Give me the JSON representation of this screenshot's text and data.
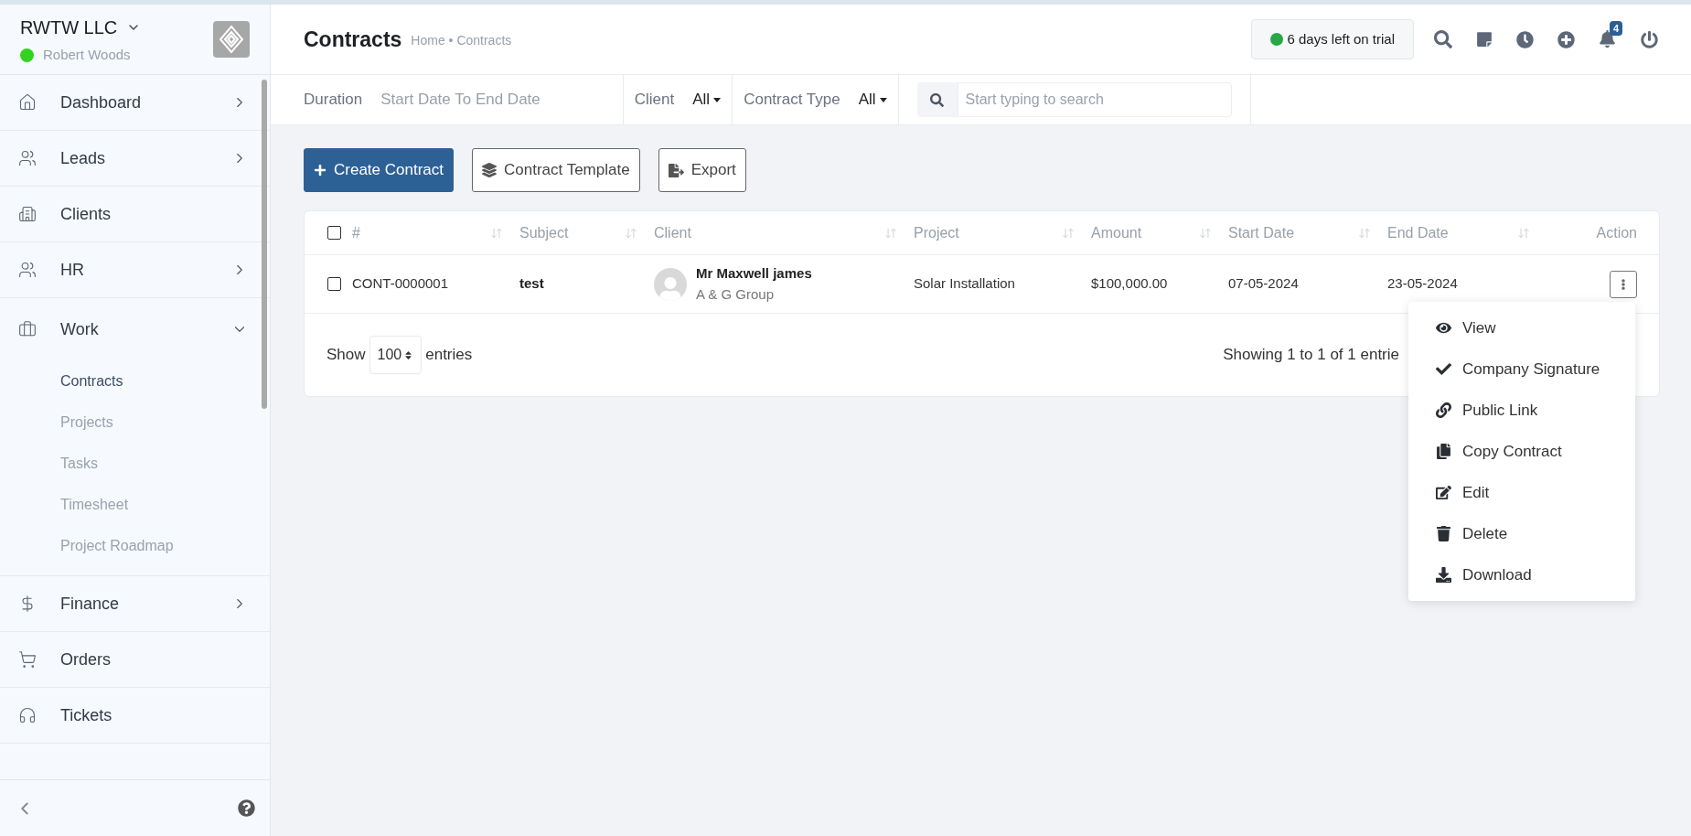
{
  "workspace": {
    "company": "RWTW LLC",
    "user": "Robert Woods",
    "online": true
  },
  "sidebar": {
    "items": [
      {
        "label": "Dashboard",
        "expandable": true,
        "expanded": false
      },
      {
        "label": "Leads",
        "expandable": true,
        "expanded": false
      },
      {
        "label": "Clients",
        "expandable": false,
        "expanded": false
      },
      {
        "label": "HR",
        "expandable": true,
        "expanded": false
      },
      {
        "label": "Work",
        "expandable": true,
        "expanded": true,
        "children": [
          {
            "label": "Contracts",
            "selected": true
          },
          {
            "label": "Projects",
            "selected": false
          },
          {
            "label": "Tasks",
            "selected": false
          },
          {
            "label": "Timesheet",
            "selected": false
          },
          {
            "label": "Project Roadmap",
            "selected": false
          }
        ]
      },
      {
        "label": "Finance",
        "expandable": true,
        "expanded": false
      },
      {
        "label": "Orders",
        "expandable": false,
        "expanded": false
      },
      {
        "label": "Tickets",
        "expandable": false,
        "expanded": false
      }
    ]
  },
  "header": {
    "title": "Contracts",
    "breadcrumb": "Home • Contracts",
    "trial": "6 days left on trial",
    "notifications": "4"
  },
  "filters": {
    "duration_label": "Duration",
    "duration_value": "Start Date To End Date",
    "client_label": "Client",
    "client_value": "All",
    "type_label": "Contract Type",
    "type_value": "All",
    "search": {
      "placeholder": "Start typing to search"
    }
  },
  "actions": [
    "Create Contract",
    "Contract Template",
    "Export"
  ],
  "table": {
    "columns": [
      "#",
      "Subject",
      "Client",
      "Project",
      "Amount",
      "Start Date",
      "End Date",
      "Action"
    ],
    "header_checked": false,
    "rows": [
      {
        "checked": false,
        "id": "CONT-0000001",
        "subject": "test",
        "client_name": "Mr Maxwell james",
        "client_company": "A & G Group",
        "project": "Solar Installation",
        "amount": "$100,000.00",
        "start": "07-05-2024",
        "end": "23-05-2024"
      }
    ],
    "show_label": "Show",
    "page_size": "100",
    "entries_label": "entries",
    "summary": "Showing 1 to 1 of 1 entrie"
  },
  "action_menu": [
    "View",
    "Company Signature",
    "Public Link",
    "Copy Contract",
    "Edit",
    "Delete",
    "Download"
  ]
}
